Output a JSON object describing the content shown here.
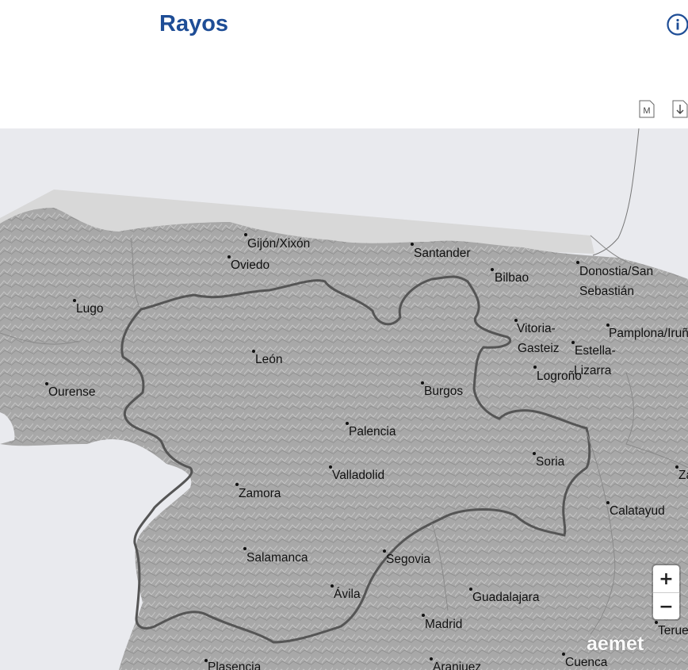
{
  "header": {
    "title": "Rayos"
  },
  "toolbar": {
    "info_icon": "info-icon",
    "metadata_label": "M",
    "download_icon": "download-icon"
  },
  "map": {
    "cities": [
      {
        "name": "Gijón/Xixón"
      },
      {
        "name": "Oviedo"
      },
      {
        "name": "Santander"
      },
      {
        "name": "Bilbao"
      },
      {
        "name": "Donostia/San"
      },
      {
        "name": "Sebastián"
      },
      {
        "name": "Lugo"
      },
      {
        "name": "Vitoria-"
      },
      {
        "name": "Gasteiz"
      },
      {
        "name": "Pamplona/Iruña"
      },
      {
        "name": "Estella-"
      },
      {
        "name": "Lizarra"
      },
      {
        "name": "León"
      },
      {
        "name": "Logroño"
      },
      {
        "name": "Ourense"
      },
      {
        "name": "Burgos"
      },
      {
        "name": "Palencia"
      },
      {
        "name": "Soria"
      },
      {
        "name": "Valladolid"
      },
      {
        "name": "Zamora"
      },
      {
        "name": "Za"
      },
      {
        "name": "Calatayud"
      },
      {
        "name": "Salamanca"
      },
      {
        "name": "Segovia"
      },
      {
        "name": "Ávila"
      },
      {
        "name": "Guadalajara"
      },
      {
        "name": "Madrid"
      },
      {
        "name": "Teruel"
      },
      {
        "name": "Plasencia"
      },
      {
        "name": "Aranjuez"
      },
      {
        "name": "Cuenca"
      }
    ],
    "zoom_in_label": "+",
    "zoom_out_label": "−",
    "attribution": "aemet",
    "colors": {
      "sea": "#e9eaee",
      "land": "#a9a9a9",
      "border": "#555555",
      "title": "#1e4d96"
    }
  }
}
